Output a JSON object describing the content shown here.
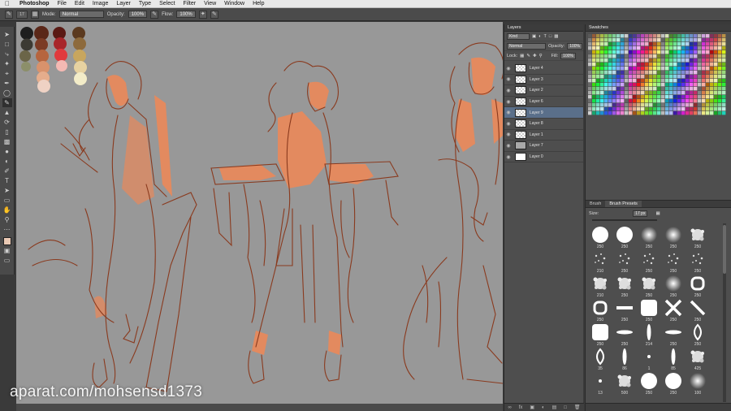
{
  "menubar": {
    "app": "Photoshop",
    "items": [
      "File",
      "Edit",
      "Image",
      "Layer",
      "Type",
      "Select",
      "Filter",
      "View",
      "Window",
      "Help"
    ]
  },
  "options": {
    "size_value": "17",
    "mode_label": "Mode:",
    "mode_value": "Normal",
    "opacity_label": "Opacity:",
    "opacity_value": "100%",
    "flow_label": "Flow:",
    "flow_value": "100%"
  },
  "layers": {
    "tab": "Layers",
    "kind_value": "Kind",
    "blend_value": "Normal",
    "opacity_label": "Opacity:",
    "opacity_value": "100%",
    "lock_label": "Lock:",
    "fill_label": "Fill:",
    "fill_value": "100%",
    "rows": [
      {
        "name": "Layer 4",
        "thumb": "trans"
      },
      {
        "name": "Layer 3",
        "thumb": "trans"
      },
      {
        "name": "Layer 2",
        "thumb": "trans"
      },
      {
        "name": "Layer 6",
        "thumb": "trans"
      },
      {
        "name": "Layer 9",
        "thumb": "trans"
      },
      {
        "name": "Layer 8",
        "thumb": "trans"
      },
      {
        "name": "Layer 1",
        "thumb": "trans"
      },
      {
        "name": "Layer 7",
        "thumb": "grey"
      },
      {
        "name": "Layer 0",
        "thumb": "solid"
      }
    ],
    "selected_index": 4
  },
  "swatches": {
    "tab": "Swatches"
  },
  "brushes": {
    "tabs": [
      "Brush",
      "Brush Presets"
    ],
    "active_tab": 1,
    "size_label": "Size:",
    "size_value": "17 px",
    "presets": [
      {
        "n": "250",
        "kind": "hard"
      },
      {
        "n": "250",
        "kind": "hard"
      },
      {
        "n": "250",
        "kind": "soft"
      },
      {
        "n": "250",
        "kind": "soft"
      },
      {
        "n": "250",
        "kind": "splat"
      },
      {
        "n": "210",
        "kind": "dots"
      },
      {
        "n": "250",
        "kind": "dots"
      },
      {
        "n": "250",
        "kind": "dots"
      },
      {
        "n": "250",
        "kind": "dots"
      },
      {
        "n": "250",
        "kind": "dots"
      },
      {
        "n": "210",
        "kind": "splat"
      },
      {
        "n": "250",
        "kind": "splat"
      },
      {
        "n": "250",
        "kind": "splat"
      },
      {
        "n": "250",
        "kind": "soft"
      },
      {
        "n": "250",
        "kind": "ring"
      },
      {
        "n": "250",
        "kind": "ring"
      },
      {
        "n": "250",
        "kind": "bar"
      },
      {
        "n": "250",
        "kind": "square"
      },
      {
        "n": "250",
        "kind": "cross"
      },
      {
        "n": "250",
        "kind": "slash"
      },
      {
        "n": "250",
        "kind": "square"
      },
      {
        "n": "250",
        "kind": "ellipse"
      },
      {
        "n": "214",
        "kind": "vellipse"
      },
      {
        "n": "250",
        "kind": "ellipse"
      },
      {
        "n": "250",
        "kind": "leaf"
      },
      {
        "n": "35",
        "kind": "leaf"
      },
      {
        "n": "86",
        "kind": "vellipse"
      },
      {
        "n": "1",
        "kind": "dot"
      },
      {
        "n": "85",
        "kind": "vellipse"
      },
      {
        "n": "425",
        "kind": "splat"
      },
      {
        "n": "13",
        "kind": "dot"
      },
      {
        "n": "500",
        "kind": "splat"
      },
      {
        "n": "250",
        "kind": "hard"
      },
      {
        "n": "250",
        "kind": "hard"
      },
      {
        "n": "100",
        "kind": "soft"
      }
    ]
  },
  "watermark": "aparat.com/mohsensd1373",
  "colors": {
    "canvas": "#989898",
    "line": "#8a3a1e",
    "skin": "#e38a5f",
    "selected_layer": "#5a6f8a"
  }
}
